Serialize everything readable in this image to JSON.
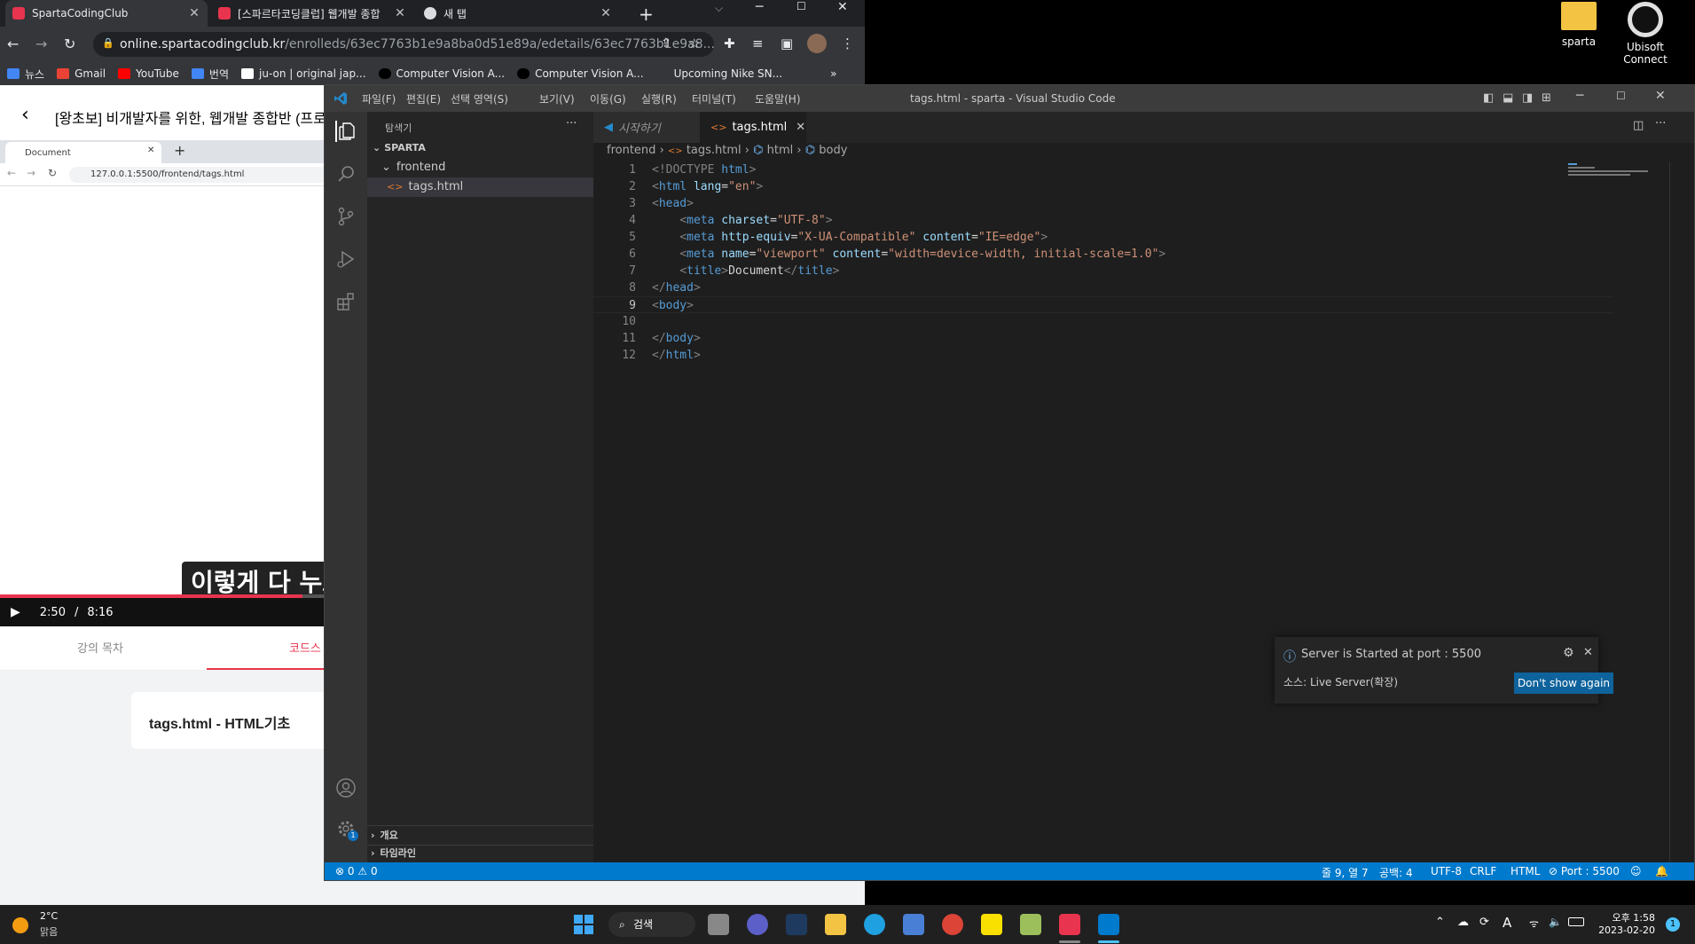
{
  "browser": {
    "tabs": [
      {
        "title": "SpartaCodingClub",
        "active": true
      },
      {
        "title": "[스파르타코딩클럽] 웹개발 종합",
        "active": false
      },
      {
        "title": "새 탭",
        "active": false
      }
    ],
    "url_host": "online.spartacodingclub.kr",
    "url_path": "/enrolleds/63ec7763b1e9a8ba0d51e89a/edetails/63ec7763b1e9a8...",
    "bookmarks": [
      "뉴스",
      "Gmail",
      "YouTube",
      "번역",
      "ju-on | original jap...",
      "Computer Vision A...",
      "Computer Vision A...",
      "Upcoming Nike SN..."
    ],
    "page": {
      "course_title": "[왕초보] 비개발자를 위한, 웹개발 종합반 (프로그",
      "inner_tab": "Document",
      "inner_url": "127.0.0.1:5500/frontend/tags.html",
      "subtitle": "이렇게 다 누르",
      "time_current": "2:50",
      "time_sep": "/",
      "time_total": "8:16",
      "progress_fraction": 0.35,
      "tab_toc": "강의 목차",
      "tab_code": "코드스",
      "card_title": "tags.html - HTML기초"
    }
  },
  "desktop": {
    "icons": [
      {
        "label": "sparta"
      },
      {
        "label": "Ubisoft Connect"
      }
    ]
  },
  "vscode": {
    "menu": [
      "파일(F)",
      "편집(E)",
      "선택 영역(S)",
      "보기(V)",
      "이동(G)",
      "실행(R)",
      "터미널(T)",
      "도움말(H)"
    ],
    "window_title": "tags.html - sparta - Visual Studio Code",
    "explorer_title": "탐색기",
    "explorer_menu": "···",
    "tree": {
      "root": "SPARTA",
      "folder": "frontend",
      "file": "tags.html"
    },
    "outline": "개요",
    "timeline": "타임라인",
    "tabs": [
      {
        "label": "시작하기",
        "active": false
      },
      {
        "label": "tags.html",
        "active": true
      }
    ],
    "breadcrumbs": [
      "frontend",
      "tags.html",
      "html",
      "body"
    ],
    "lines": [
      {
        "n": "1",
        "parts": [
          [
            "t-br",
            "<!DOCTYPE "
          ],
          [
            "t-tag",
            "html"
          ],
          [
            "t-br",
            ">"
          ]
        ]
      },
      {
        "n": "2",
        "parts": [
          [
            "t-br",
            "<"
          ],
          [
            "t-tag",
            "html"
          ],
          [
            "t-txt",
            " "
          ],
          [
            "t-attr",
            "lang"
          ],
          [
            "t-txt",
            "="
          ],
          [
            "t-str",
            "\"en\""
          ],
          [
            "t-br",
            ">"
          ]
        ]
      },
      {
        "n": "3",
        "parts": [
          [
            "t-br",
            "<"
          ],
          [
            "t-tag",
            "head"
          ],
          [
            "t-br",
            ">"
          ]
        ]
      },
      {
        "n": "4",
        "parts": [
          [
            "t-txt",
            "    "
          ],
          [
            "t-br",
            "<"
          ],
          [
            "t-tag",
            "meta"
          ],
          [
            "t-txt",
            " "
          ],
          [
            "t-attr",
            "charset"
          ],
          [
            "t-txt",
            "="
          ],
          [
            "t-str",
            "\"UTF-8\""
          ],
          [
            "t-br",
            ">"
          ]
        ]
      },
      {
        "n": "5",
        "parts": [
          [
            "t-txt",
            "    "
          ],
          [
            "t-br",
            "<"
          ],
          [
            "t-tag",
            "meta"
          ],
          [
            "t-txt",
            " "
          ],
          [
            "t-attr",
            "http-equiv"
          ],
          [
            "t-txt",
            "="
          ],
          [
            "t-str",
            "\"X-UA-Compatible\""
          ],
          [
            "t-txt",
            " "
          ],
          [
            "t-attr",
            "content"
          ],
          [
            "t-txt",
            "="
          ],
          [
            "t-str",
            "\"IE=edge\""
          ],
          [
            "t-br",
            ">"
          ]
        ]
      },
      {
        "n": "6",
        "parts": [
          [
            "t-txt",
            "    "
          ],
          [
            "t-br",
            "<"
          ],
          [
            "t-tag",
            "meta"
          ],
          [
            "t-txt",
            " "
          ],
          [
            "t-attr",
            "name"
          ],
          [
            "t-txt",
            "="
          ],
          [
            "t-str",
            "\"viewport\""
          ],
          [
            "t-txt",
            " "
          ],
          [
            "t-attr",
            "content"
          ],
          [
            "t-txt",
            "="
          ],
          [
            "t-str",
            "\"width=device-width, initial-scale=1.0\""
          ],
          [
            "t-br",
            ">"
          ]
        ]
      },
      {
        "n": "7",
        "parts": [
          [
            "t-txt",
            "    "
          ],
          [
            "t-br",
            "<"
          ],
          [
            "t-tag",
            "title"
          ],
          [
            "t-br",
            ">"
          ],
          [
            "t-txt",
            "Document"
          ],
          [
            "t-br",
            "</"
          ],
          [
            "t-tag",
            "title"
          ],
          [
            "t-br",
            ">"
          ]
        ]
      },
      {
        "n": "8",
        "parts": [
          [
            "t-br",
            "</"
          ],
          [
            "t-tag",
            "head"
          ],
          [
            "t-br",
            ">"
          ]
        ]
      },
      {
        "n": "9",
        "parts": [
          [
            "t-br",
            "<"
          ],
          [
            "t-tag",
            "body"
          ],
          [
            "t-br",
            ">"
          ]
        ],
        "current": true
      },
      {
        "n": "10",
        "parts": []
      },
      {
        "n": "11",
        "parts": [
          [
            "t-br",
            "</"
          ],
          [
            "t-tag",
            "body"
          ],
          [
            "t-br",
            ">"
          ]
        ]
      },
      {
        "n": "12",
        "parts": [
          [
            "t-br",
            "</"
          ],
          [
            "t-tag",
            "html"
          ],
          [
            "t-br",
            ">"
          ]
        ]
      }
    ],
    "notification": {
      "message": "Server is Started at port : 5500",
      "source": "소스: Live Server(확장)",
      "button": "Don't show again"
    },
    "status": {
      "errors": "0",
      "warnings": "0",
      "position": "줄 9, 열 7",
      "spaces": "공백: 4",
      "encoding": "UTF-8",
      "eol": "CRLF",
      "language": "HTML",
      "port": "Port : 5500"
    }
  },
  "taskbar": {
    "weather_temp": "2°C",
    "weather_desc": "맑음",
    "search": "검색",
    "time": "오후 1:58",
    "date": "2023-02-20",
    "notif_count": "1",
    "ime": "A"
  },
  "colors": {
    "vscode_accent": "#007acc",
    "sparta_red": "#e8344e"
  }
}
